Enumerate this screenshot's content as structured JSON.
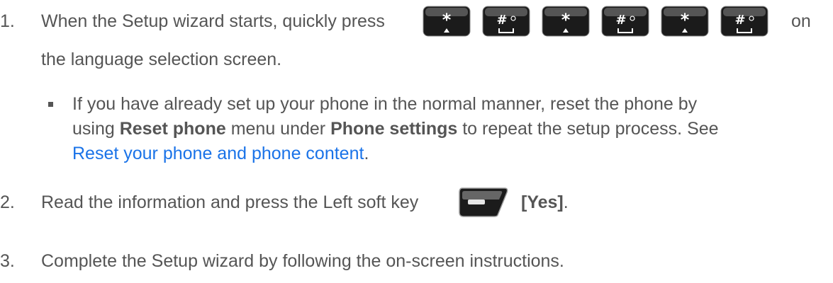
{
  "steps": [
    {
      "number": "1.",
      "line1_text": "When the Setup wizard starts, quickly press",
      "line1_trailing": "on",
      "line2_text": "the language selection screen.",
      "key_sequence": [
        "asterisk-key-icon",
        "hash-key-icon",
        "asterisk-key-icon",
        "hash-key-icon",
        "asterisk-key-icon",
        "hash-key-icon"
      ]
    },
    {
      "number": "2.",
      "text_before": "Read the information and press the Left soft key",
      "bold_text": "[Yes]",
      "text_after": ".",
      "icon": "left-soft-key-icon"
    },
    {
      "number": "3.",
      "text": "Complete the Setup wizard by following the on-screen instructions."
    }
  ],
  "bullet": {
    "line1": "If you have already set up your phone in the normal manner, reset the phone by",
    "line2_a": "using ",
    "line2_b1": "Reset phone",
    "line2_c": " menu under ",
    "line2_b2": "Phone settings",
    "line2_d": " to repeat the setup process. See",
    "link_text": "Reset your phone and phone content",
    "link_trailing": "."
  },
  "colors": {
    "text": "#555555",
    "link": "#1a73e8",
    "key_dark": "#1b1b1b"
  }
}
